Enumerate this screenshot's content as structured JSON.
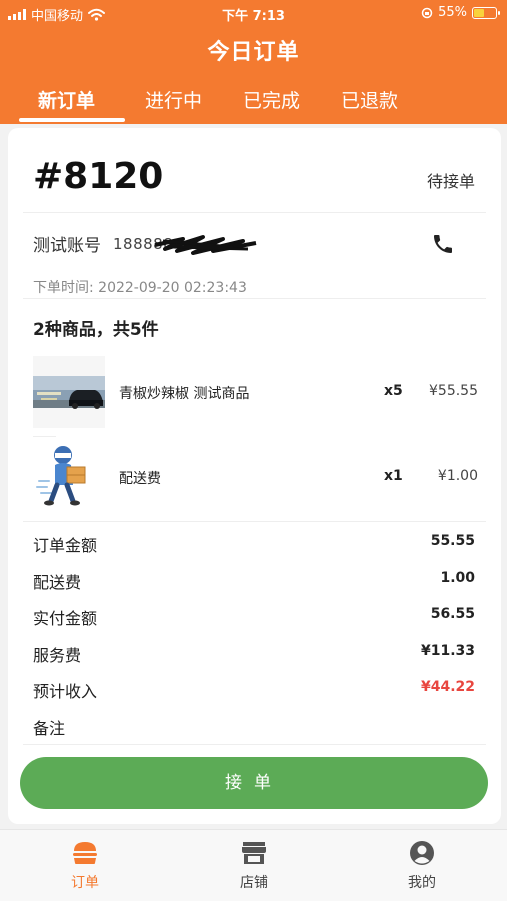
{
  "status_bar": {
    "carrier": "中国移动",
    "time": "下午 7:13",
    "battery": "55%",
    "battery_level": 0.55
  },
  "header": {
    "title": "今日订单",
    "tabs": [
      {
        "label": "新订单",
        "active": true
      },
      {
        "label": "进行中",
        "active": false
      },
      {
        "label": "已完成",
        "active": false
      },
      {
        "label": "已退款",
        "active": false
      }
    ]
  },
  "order": {
    "number": "#8120",
    "status": "待接单",
    "customer_name": "测试账号",
    "customer_phone": "188",
    "order_time": "下单时间: 2022-09-20 02:23:43",
    "summary": "2种商品，共5件",
    "items": [
      {
        "name": "青椒炒辣椒 测试商品",
        "qty": "x5",
        "price": "¥55.55",
        "thumb": "car-photo"
      },
      {
        "name": "配送费",
        "qty": "x1",
        "price": "¥1.00",
        "thumb": "delivery-person-illustration"
      }
    ],
    "fees": [
      {
        "label": "订单金额",
        "value": "55.55",
        "highlight": false
      },
      {
        "label": "配送费",
        "value": "1.00",
        "highlight": false
      },
      {
        "label": "实付金额",
        "value": "56.55",
        "highlight": false
      },
      {
        "label": "服务费",
        "value": "¥11.33",
        "highlight": false
      },
      {
        "label": "预计收入",
        "value": "¥44.22",
        "highlight": true
      },
      {
        "label": "备注",
        "value": "",
        "highlight": false
      }
    ],
    "accept_label": "接单"
  },
  "tabbar": {
    "items": [
      {
        "label": "订单",
        "icon": "burger-icon",
        "active": true
      },
      {
        "label": "店铺",
        "icon": "store-icon",
        "active": false
      },
      {
        "label": "我的",
        "icon": "profile-icon",
        "active": false
      }
    ]
  },
  "colors": {
    "brand": "#f47a30",
    "accept": "#5cab56",
    "income": "#e8463f"
  }
}
